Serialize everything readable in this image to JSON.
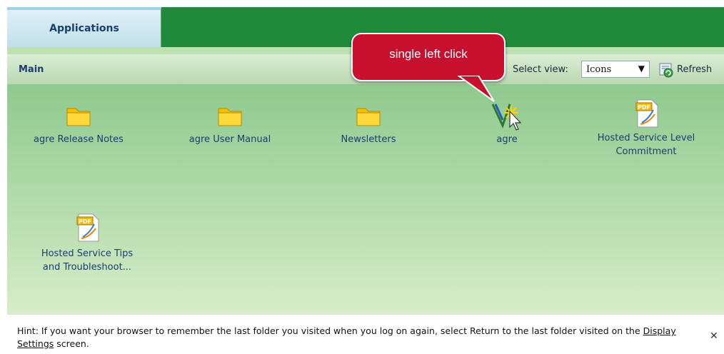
{
  "tabs": [
    {
      "label": "Applications",
      "active": true
    }
  ],
  "header": {
    "title": "Main",
    "select_view_label": "Select view:",
    "select_view_value": "Icons",
    "refresh_label": "Refresh"
  },
  "items": [
    {
      "label": "agre Release Notes",
      "icon": "folder-icon"
    },
    {
      "label": "agre User Manual",
      "icon": "folder-icon"
    },
    {
      "label": "Newsletters",
      "icon": "folder-icon"
    },
    {
      "label": "agre",
      "icon": "app-icon"
    },
    {
      "label_line1": "Hosted Service Level",
      "label_line2": "Commitment",
      "icon": "pdf-icon"
    },
    {
      "label_line1": "Hosted Service Tips",
      "label_line2": "and Troubleshoot...",
      "icon": "pdf-icon"
    }
  ],
  "callout": {
    "text": "single left click"
  },
  "hint": {
    "prefix": "Hint: If you want your browser to remember the last folder you visited when you log on again, select Return to the last folder visited on the ",
    "link": "Display Settings",
    "suffix": " screen.",
    "close": "✕"
  },
  "colors": {
    "tab_bar": "#1f8a3a",
    "callout": "#c8102e",
    "label_text": "#1b3d6e"
  }
}
